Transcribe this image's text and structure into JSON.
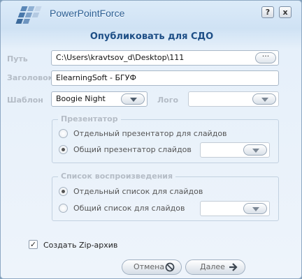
{
  "app": {
    "brand": "PowerPointForce",
    "help_label": "?",
    "close_label": "x"
  },
  "dialog": {
    "title": "Опубликовать для СДО"
  },
  "form": {
    "path_label": "Путь",
    "path_value": "C:\\Users\\kravtsov_d\\Desktop\\111",
    "browse_label": "···",
    "header_label": "Заголовок",
    "header_value": "ElearningSoft - БГУФ",
    "template_label": "Шаблон",
    "template_value": "Boogie Night",
    "logo_label": "Лого",
    "logo_value": ""
  },
  "presenter_group": {
    "title": "Презентатор",
    "options": [
      {
        "label": "Отдельный презентатор для слайдов",
        "selected": false
      },
      {
        "label": "Общий презентатор слайдов",
        "selected": true
      }
    ]
  },
  "playlist_group": {
    "title": "Список воспроизведения",
    "options": [
      {
        "label": "Отдельный список для слайдов",
        "selected": true
      },
      {
        "label": "Общий список для слайдов",
        "selected": false
      }
    ]
  },
  "zip": {
    "label": "Создать Zip-архив",
    "checked": true,
    "check_mark": "✓"
  },
  "buttons": {
    "cancel": "Отмена",
    "next": "Далее"
  },
  "colors": {
    "title": "#1d4e86",
    "brand": "#2c5f93",
    "disabled_text": "#b4bcc6"
  }
}
